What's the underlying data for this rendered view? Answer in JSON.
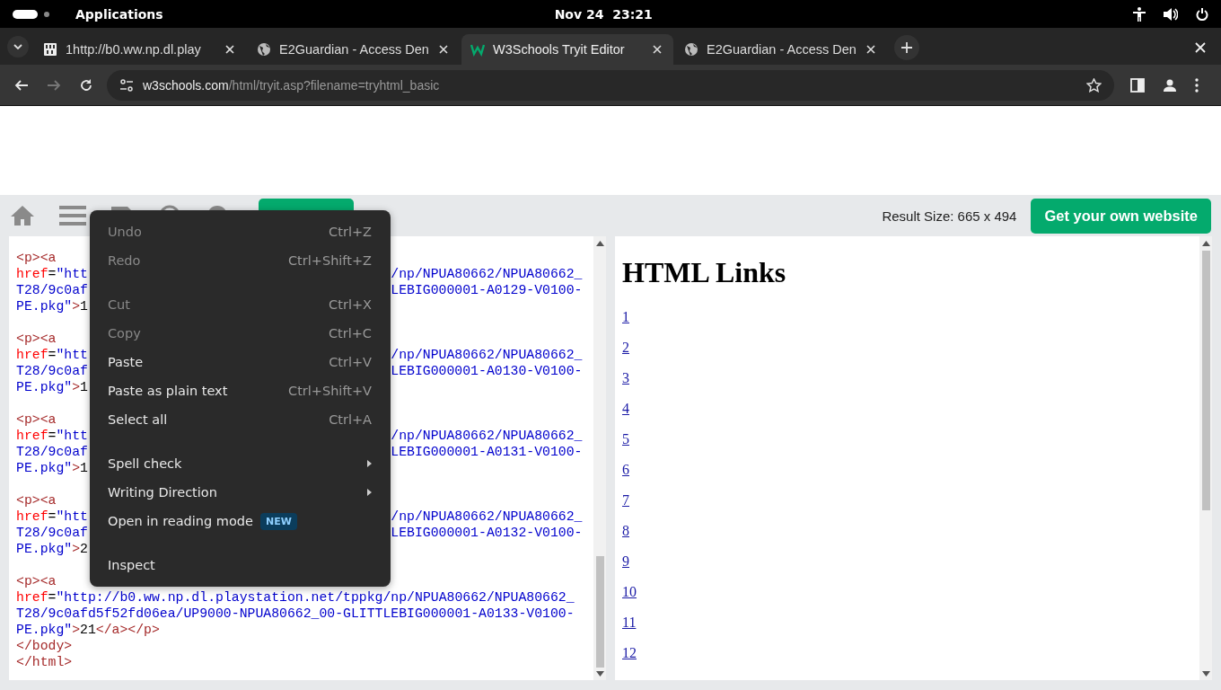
{
  "system_bar": {
    "label": "Applications",
    "clock": "Nov 24  23:21"
  },
  "tabs": [
    {
      "title": "1http://b0.ww.np.dl.play",
      "kind": "binary",
      "selected": false
    },
    {
      "title": "E2Guardian - Access Den",
      "kind": "globe",
      "selected": false
    },
    {
      "title": "W3Schools Tryit Editor",
      "kind": "logo",
      "selected": true
    },
    {
      "title": "E2Guardian - Access Den",
      "kind": "globe",
      "selected": false
    }
  ],
  "nav_buttons": [
    {
      "kind": "back",
      "disabled": false
    },
    {
      "kind": "forward",
      "disabled": true
    },
    {
      "kind": "reload",
      "disabled": false
    }
  ],
  "address": "w3schools.com/html/tryit.asp?filename=tryhtml_basic",
  "editor_toolbar": {
    "result_size": "Result Size: 665 x 494",
    "cta": "Get your own website"
  },
  "code_blocks": [
    [
      {
        "text": "<p><a"
      },
      {
        "text": "href=\"htt",
        "text_right": "/np/NPUA80662/NPUA80662_"
      },
      {
        "text": "T28/9c0af",
        "text_right": "LEBIG000001-A0129-V0100-"
      },
      {
        "text": "PE.pkg\">1"
      }
    ],
    [
      {
        "text": "<p><a"
      },
      {
        "text": "href=\"htt",
        "text_right": "/np/NPUA80662/NPUA80662_"
      },
      {
        "text": "T28/9c0af",
        "text_right": "LEBIG000001-A0130-V0100-"
      },
      {
        "text": "PE.pkg\">1"
      }
    ],
    [
      {
        "text": "<p><a"
      },
      {
        "text": "href=\"htt",
        "text_right": "/np/NPUA80662/NPUA80662_"
      },
      {
        "text": "T28/9c0af",
        "text_right": "LEBIG000001-A0131-V0100-"
      },
      {
        "text": "PE.pkg\">1"
      }
    ],
    [
      {
        "text": "<p><a"
      },
      {
        "text": "href=\"htt",
        "text_right": "/np/NPUA80662/NPUA80662_"
      },
      {
        "text": "T28/9c0af",
        "text_right": "LEBIG000001-A0132-V0100-"
      },
      {
        "text": "PE.pkg\">2"
      }
    ],
    [
      {
        "text": "<p><a"
      },
      {
        "text": "href=\"http://b0.ww.np.dl.playstation.net/tppkg/np/NPUA80662/NPUA80662_"
      },
      {
        "text": "T28/9c0afd5f52fd06ea/UP9000-NPUA80662_00-GLITTLEBIG000001-A0133-V0100-"
      },
      {
        "text": "PE.pkg\">21</a></p>"
      },
      {
        "text": "</body>"
      },
      {
        "text": "</html>"
      }
    ]
  ],
  "result": {
    "heading": "HTML Links",
    "links": [
      "1",
      "2",
      "3",
      "4",
      "5",
      "6",
      "7",
      "8",
      "9",
      "10",
      "11",
      "12"
    ]
  },
  "context_menu": {
    "groups": [
      [
        {
          "label": "Undo",
          "shortcut": "Ctrl+Z",
          "disabled": true
        },
        {
          "label": "Redo",
          "shortcut": "Ctrl+Shift+Z",
          "disabled": true
        }
      ],
      [
        {
          "label": "Cut",
          "shortcut": "Ctrl+X",
          "disabled": true
        },
        {
          "label": "Copy",
          "shortcut": "Ctrl+C",
          "disabled": true
        },
        {
          "label": "Paste",
          "shortcut": "Ctrl+V",
          "disabled": false
        },
        {
          "label": "Paste as plain text",
          "shortcut": "Ctrl+Shift+V",
          "disabled": false
        },
        {
          "label": "Select all",
          "shortcut": "Ctrl+A",
          "disabled": false
        }
      ],
      [
        {
          "label": "Spell check",
          "submenu": true,
          "disabled": false
        },
        {
          "label": "Writing Direction",
          "submenu": true,
          "disabled": false
        },
        {
          "label": "Open in reading mode",
          "badge": "NEW",
          "disabled": false
        }
      ],
      [
        {
          "label": "Inspect",
          "disabled": false
        }
      ]
    ]
  }
}
